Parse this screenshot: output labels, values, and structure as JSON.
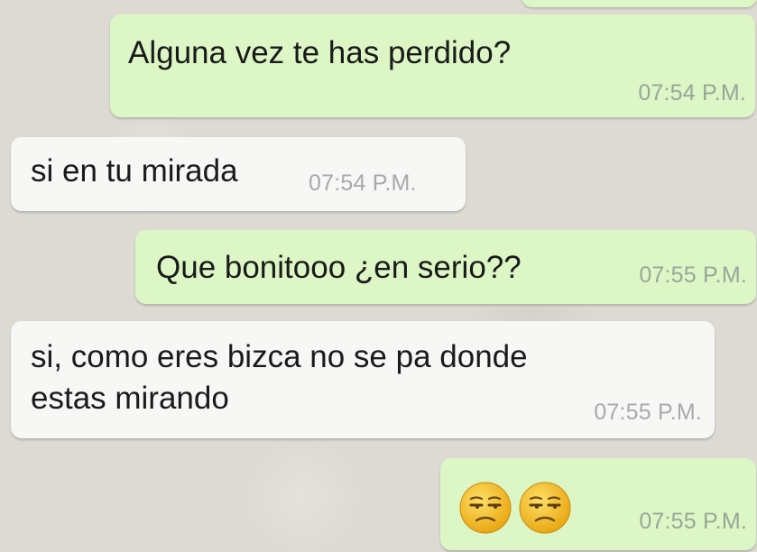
{
  "messages": [
    {
      "direction": "outgoing",
      "text": "Alguna vez te has perdido?",
      "time": "07:54 P.M."
    },
    {
      "direction": "incoming",
      "text": "si en tu mirada",
      "time": "07:54 P.M."
    },
    {
      "direction": "outgoing",
      "text": "Que bonitooo ¿en serio??",
      "time": "07:55 P.M."
    },
    {
      "direction": "incoming",
      "lines": [
        "si, como eres bizca no se pa donde",
        "estas mirando"
      ],
      "time": "07:55 P.M."
    },
    {
      "direction": "outgoing",
      "emoji": [
        "unamused-face-icon",
        "unamused-face-icon"
      ],
      "time": "07:55 P.M."
    }
  ],
  "colors": {
    "outgoing_bubble": "#dcf7c5",
    "incoming_bubble": "#f7f7f5",
    "background": "#dcdad3",
    "emoji_face": "#f6c12c"
  }
}
